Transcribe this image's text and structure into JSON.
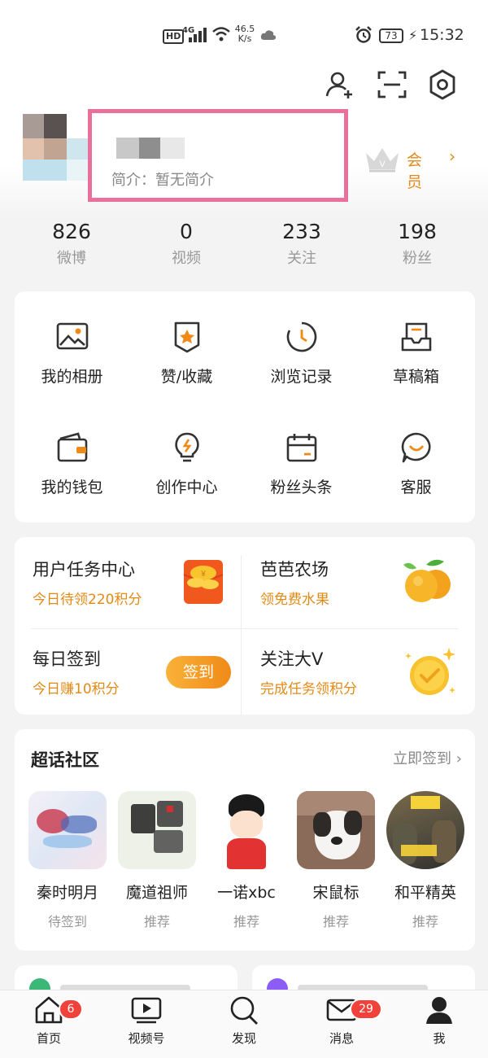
{
  "status_bar": {
    "hd": "HD",
    "network": "4G",
    "speed": "46.5",
    "speed_unit": "K/s",
    "battery": "73",
    "time": "15:32"
  },
  "header_icons": [
    "add-friend-icon",
    "scan-icon",
    "settings-icon"
  ],
  "profile": {
    "bio": "简介：暂无简介",
    "vip_label": "会员"
  },
  "stats": [
    {
      "value": "826",
      "label": "微博"
    },
    {
      "value": "0",
      "label": "视频"
    },
    {
      "value": "233",
      "label": "关注"
    },
    {
      "value": "198",
      "label": "粉丝"
    }
  ],
  "tools": [
    {
      "label": "我的相册",
      "icon": "photo-album-icon"
    },
    {
      "label": "赞/收藏",
      "icon": "favorites-icon"
    },
    {
      "label": "浏览记录",
      "icon": "history-icon"
    },
    {
      "label": "草稿箱",
      "icon": "drafts-icon"
    },
    {
      "label": "我的钱包",
      "icon": "wallet-icon"
    },
    {
      "label": "创作中心",
      "icon": "creator-bulb-icon"
    },
    {
      "label": "粉丝头条",
      "icon": "fan-headline-icon"
    },
    {
      "label": "客服",
      "icon": "customer-service-icon"
    }
  ],
  "tasks": [
    {
      "title": "用户任务中心",
      "subtitle": "今日待领220积分"
    },
    {
      "title": "芭芭农场",
      "subtitle": "领免费水果"
    },
    {
      "title": "每日签到",
      "subtitle": "今日赚10积分",
      "button": "签到"
    },
    {
      "title": "关注大V",
      "subtitle": "完成任务领积分"
    }
  ],
  "super_topics": {
    "title": "超话社区",
    "action": "立即签到",
    "items": [
      {
        "name": "秦时明月",
        "status": "待签到"
      },
      {
        "name": "魔道祖师",
        "status": "推荐"
      },
      {
        "name": "一诺xbc",
        "status": "推荐"
      },
      {
        "name": "宋鼠标",
        "status": "推荐"
      },
      {
        "name": "和平精英",
        "status": "推荐"
      }
    ]
  },
  "tabbar": [
    {
      "label": "首页",
      "badge": "6"
    },
    {
      "label": "视频号"
    },
    {
      "label": "发现"
    },
    {
      "label": "消息",
      "badge": "29"
    },
    {
      "label": "我"
    }
  ],
  "colors": {
    "accent": "#e38a16",
    "highlight_border": "#e8709a",
    "badge": "#f0423b"
  }
}
